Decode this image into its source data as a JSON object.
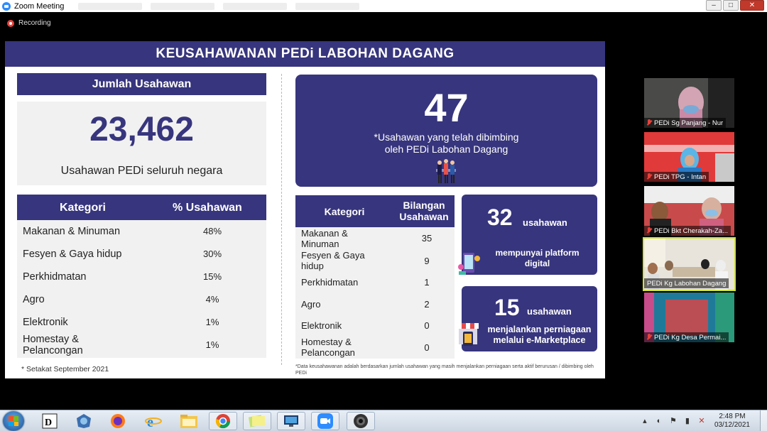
{
  "window": {
    "title": "Zoom Meeting",
    "recording_label": "Recording"
  },
  "slide": {
    "title": "KEUSAHAWANAN PEDi LABOHAN DAGANG",
    "left": {
      "box_title": "Jumlah Usahawan",
      "total": "23,462",
      "total_desc": "Usahawan PEDi seluruh negara",
      "table": {
        "headers": [
          "Kategori",
          "% Usahawan"
        ],
        "rows": [
          {
            "k": "Makanan & Minuman",
            "v": "48%"
          },
          {
            "k": "Fesyen & Gaya hidup",
            "v": "30%"
          },
          {
            "k": "Perkhidmatan",
            "v": "15%"
          },
          {
            "k": "Agro",
            "v": "4%"
          },
          {
            "k": "Elektronik",
            "v": "1%"
          },
          {
            "k": "Homestay & Pelancongan",
            "v": "1%"
          }
        ]
      },
      "note": "* Setakat September 2021"
    },
    "right": {
      "guided_count": "47",
      "guided_desc_1": "*Usahawan yang telah dibimbing",
      "guided_desc_2": "oleh PEDi Labohan Dagang",
      "table": {
        "headers": [
          "Kategori",
          "Bilangan Usahawan"
        ],
        "header_c2_line1": "Bilangan",
        "header_c2_line2": "Usahawan",
        "rows": [
          {
            "k": "Makanan & Minuman",
            "v": "35"
          },
          {
            "k": "Fesyen & Gaya hidup",
            "v": "9"
          },
          {
            "k": "Perkhidmatan",
            "v": "1"
          },
          {
            "k": "Agro",
            "v": "2"
          },
          {
            "k": "Elektronik",
            "v": "0"
          },
          {
            "k": "Homestay & Pelancongan",
            "v": "0"
          }
        ]
      },
      "note": "*Data keusahawanan adalah berdasarkan jumlah usahawan yang masih menjalankan perniagaan serta aktif berurusan / dibimbing oleh PEDi",
      "platform": {
        "count": "32",
        "unit": "usahawan",
        "desc_1": "mempunyai platform",
        "desc_2": "digital"
      },
      "marketplace": {
        "count": "15",
        "unit": "usahawan",
        "desc_1": "menjalankan perniagaan",
        "desc_2": "melalui e-Marketplace"
      }
    }
  },
  "participants": [
    {
      "name": "PEDi Sg Panjang - Nur",
      "muted": true
    },
    {
      "name": "PEDi TPG - Intan",
      "muted": true
    },
    {
      "name": "PEDi Bkt Cherakah-Za...",
      "muted": true
    },
    {
      "name": "PEDi Kg Labohan Dagang",
      "muted": false,
      "active": true
    },
    {
      "name": "PEDi Kg Desa Permai...",
      "muted": true
    }
  ],
  "taskbar": {
    "time": "2:48 PM",
    "date": "03/12/2021",
    "apps": [
      "start-button",
      "word-icon",
      "globe-icon",
      "firefox-icon",
      "internet-explorer-icon",
      "file-explorer-icon",
      "chrome-icon",
      "notes-icon",
      "remote-desktop-icon",
      "zoom-icon",
      "camera-icon"
    ]
  },
  "colors": {
    "navy": "#37357d",
    "panel": "#f1f1f1",
    "active_border": "#cfe23a"
  }
}
